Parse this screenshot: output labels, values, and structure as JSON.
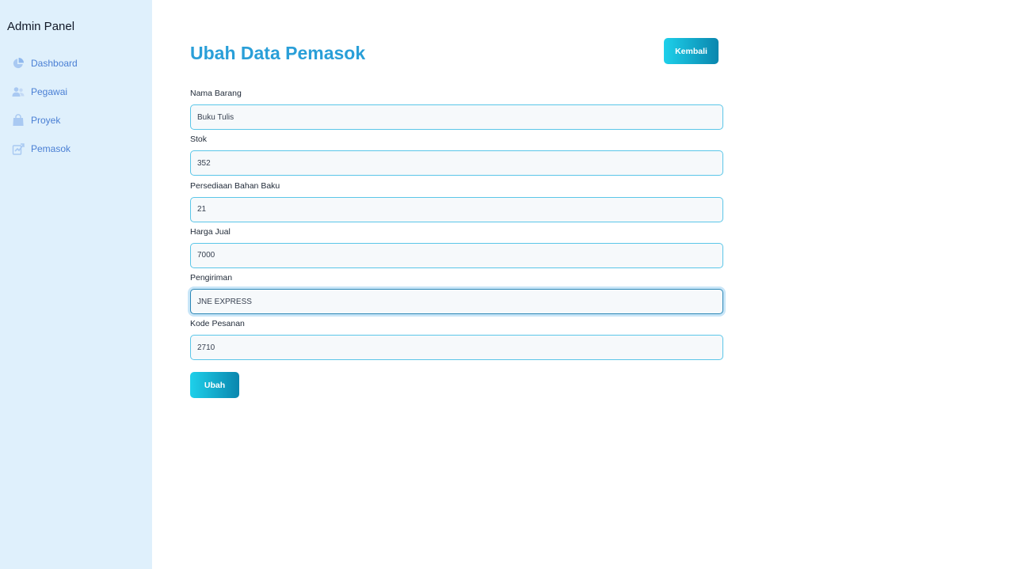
{
  "sidebar": {
    "brand": "Admin Panel",
    "items": [
      {
        "label": "Dashboard",
        "icon": "pie-chart-icon"
      },
      {
        "label": "Pegawai",
        "icon": "users-icon"
      },
      {
        "label": "Proyek",
        "icon": "shopping-bag-icon"
      },
      {
        "label": "Pemasok",
        "icon": "supplier-icon"
      }
    ]
  },
  "header": {
    "title": "Ubah Data Pemasok",
    "back_label": "Kembali"
  },
  "form": {
    "fields": [
      {
        "label": "Nama Barang",
        "value": "Buku Tulis"
      },
      {
        "label": "Stok",
        "value": "352"
      },
      {
        "label": "Persediaan Bahan Baku",
        "value": "21"
      },
      {
        "label": "Harga Jual",
        "value": "7000"
      },
      {
        "label": "Pengiriman",
        "value": "JNE EXPRESS",
        "focused": true
      },
      {
        "label": "Kode Pesanan",
        "value": "2710"
      }
    ],
    "submit_label": "Ubah"
  },
  "colors": {
    "sidebar_bg": "#dff0fc",
    "title": "#2a9fd8",
    "nav_text": "#4a7fd4",
    "button_gradient_start": "#1ed0ea",
    "button_gradient_end": "#0a86ae",
    "input_border": "#5bc6e8"
  }
}
